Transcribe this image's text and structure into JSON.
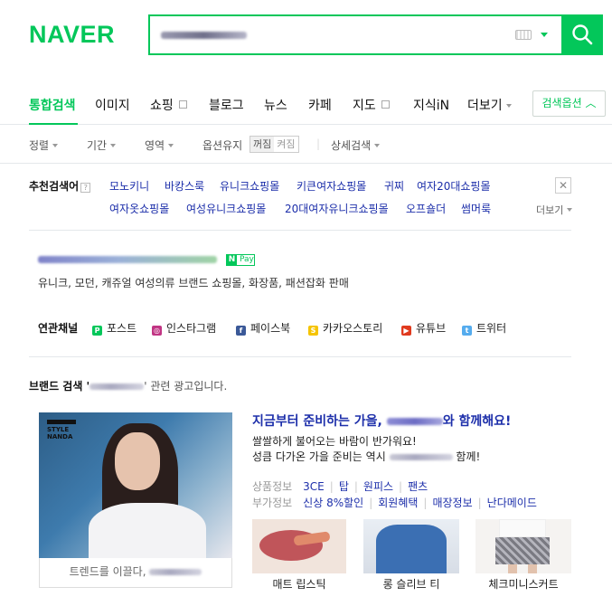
{
  "header": {
    "logo": "NAVER"
  },
  "tabs": {
    "items": [
      {
        "label": "통합검색"
      },
      {
        "label": "이미지"
      },
      {
        "label": "쇼핑"
      },
      {
        "label": "블로그"
      },
      {
        "label": "뉴스"
      },
      {
        "label": "카페"
      },
      {
        "label": "지도"
      },
      {
        "label": "지식iN"
      },
      {
        "label": "더보기"
      }
    ],
    "options_button": "검색옵션"
  },
  "filters": {
    "sort": "정렬",
    "period": "기간",
    "area": "영역",
    "keep_options": "옵션유지",
    "toggle_off": "꺼짐",
    "toggle_on": "켜짐",
    "detail": "상세검색"
  },
  "related": {
    "title": "추천검색어",
    "help": "?",
    "more": "더보기",
    "row1": [
      "모노키니",
      "바캉스룩",
      "유니크쇼핑몰",
      "키큰여자쇼핑몰",
      "귀찌",
      "여자20대쇼핑몰"
    ],
    "row2": [
      "여자옷쇼핑몰",
      "여성유니크쇼핑몰",
      "20대여자유니크쇼핑몰",
      "오프숄더",
      "썸머룩"
    ]
  },
  "ad": {
    "npay_n": "N",
    "npay_text": "Pay",
    "description": "유니크, 모던, 캐쥬얼 여성의류 브랜드 쇼핑몰, 화장품, 패션잡화 판매",
    "channels_title": "연관채널",
    "channels": [
      {
        "label": "포스트",
        "icon": "post-icon",
        "color": "#03c75a"
      },
      {
        "label": "인스타그램",
        "icon": "instagram-icon",
        "color": "#c13584"
      },
      {
        "label": "페이스북",
        "icon": "facebook-icon",
        "color": "#3b5998"
      },
      {
        "label": "카카오스토리",
        "icon": "kakaostory-icon",
        "color": "#f5c400"
      },
      {
        "label": "유튜브",
        "icon": "youtube-icon",
        "color": "#e03a1e"
      },
      {
        "label": "트위터",
        "icon": "twitter-icon",
        "color": "#55acee"
      }
    ]
  },
  "brand": {
    "title_prefix": "브랜드 검색 '",
    "title_suffix": "' 관련 광고입니다.",
    "image_label_line1": "STYLE",
    "image_label_line2": "NANDA",
    "caption": "트렌드를 이끌다,",
    "headline_prefix": "지금부터 준비하는 가을,",
    "headline_suffix": "와 함께해요!",
    "desc1": "쌀쌀하게 불어오는 바람이 반가워요!",
    "desc2_prefix": "성큼 다가온 가을 준비는 역시",
    "desc2_suffix": "함께!",
    "info1_label": "상품정보",
    "info1_links": [
      "3CE",
      "탑",
      "원피스",
      "팬츠"
    ],
    "info2_label": "부가정보",
    "info2_links": [
      "신상 8%할인",
      "회원혜택",
      "매장정보",
      "난다메이드"
    ],
    "thumbs": [
      {
        "label": "매트 립스틱"
      },
      {
        "label": "롱 슬리브 티"
      },
      {
        "label": "체크미니스커트"
      }
    ]
  },
  "colors": {
    "brand_green": "#03c75a",
    "link_blue": "#1d2faa"
  }
}
